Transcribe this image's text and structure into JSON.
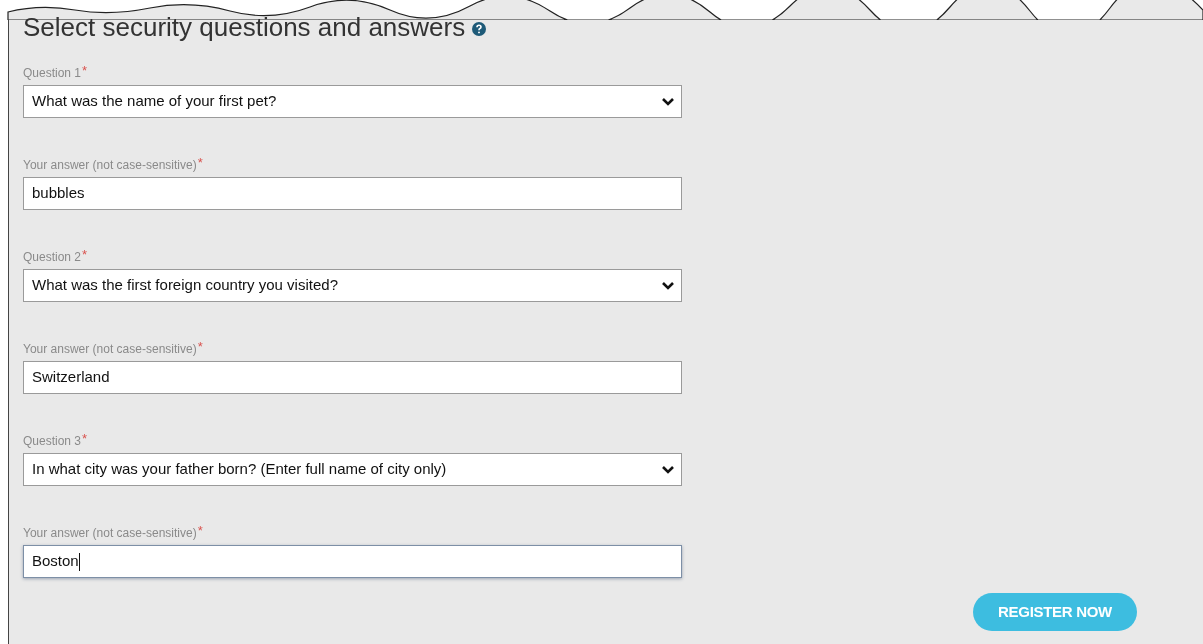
{
  "title": "Select security questions and answers",
  "pairs": [
    {
      "question_label": "Question 1",
      "question_mark": "*",
      "question": "What was the name of your first pet?",
      "answer_label": "Your answer (not case-sensitive)",
      "answer_mark": "*",
      "answer": "bubbles",
      "focused": false
    },
    {
      "question_label": "Question 2",
      "question_mark": "*",
      "question": "What was the first foreign country you visited?",
      "answer_label": "Your answer (not case-sensitive)",
      "answer_mark": "*",
      "answer": "Switzerland",
      "focused": false
    },
    {
      "question_label": "Question 3",
      "question_mark": "*",
      "question": "In what city was your father born? (Enter full name of city only)",
      "answer_label": "Your answer (not case-sensitive)",
      "answer_mark": "*",
      "answer": "Boston",
      "focused": true
    }
  ],
  "button": "REGISTER NOW"
}
